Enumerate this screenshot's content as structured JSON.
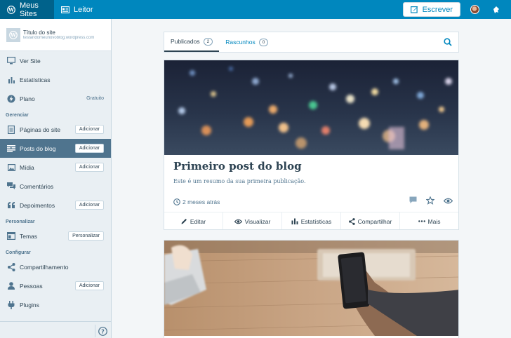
{
  "masterbar": {
    "my_sites": "Meus Sites",
    "reader": "Leitor",
    "write": "Escrever",
    "icons": [
      "wordpress-icon",
      "reader-icon",
      "write-icon",
      "avatar",
      "notifications-icon"
    ]
  },
  "site": {
    "title": "Título do site",
    "url": "testandomeunovoblog.wordpress.com"
  },
  "sidebar": {
    "top_items": [
      {
        "label": "Ver Site",
        "icon": "monitor-icon"
      },
      {
        "label": "Estatísticas",
        "icon": "stats-icon"
      },
      {
        "label": "Plano",
        "icon": "plan-icon",
        "extra": "Gratuito"
      }
    ],
    "manage_heading": "Gerenciar",
    "manage_items": [
      {
        "label": "Páginas do site",
        "button": "Adicionar",
        "icon": "pages-icon"
      },
      {
        "label": "Posts do blog",
        "button": "Adicionar",
        "icon": "posts-icon",
        "selected": true
      },
      {
        "label": "Mídia",
        "button": "Adicionar",
        "icon": "media-icon"
      },
      {
        "label": "Comentários",
        "icon": "comments-icon"
      },
      {
        "label": "Depoimentos",
        "button": "Adicionar",
        "icon": "quote-icon"
      }
    ],
    "personalize_heading": "Personalizar",
    "personalize_items": [
      {
        "label": "Temas",
        "button": "Personalizar",
        "icon": "themes-icon"
      }
    ],
    "configure_heading": "Configurar",
    "configure_items": [
      {
        "label": "Compartilhamento",
        "icon": "share-icon"
      },
      {
        "label": "Pessoas",
        "button": "Adicionar",
        "icon": "people-icon"
      },
      {
        "label": "Plugins",
        "icon": "plugins-icon"
      }
    ],
    "help_icon": "help-icon"
  },
  "tabs": {
    "published": "Publicados",
    "published_count": "2",
    "drafts": "Rascunhos",
    "drafts_count": "0"
  },
  "post": {
    "title": "Primeiro post do blog",
    "excerpt": "Este é um resumo da sua primeira publicação.",
    "time": "2 meses atrás",
    "actions": {
      "edit": "Editar",
      "view": "Visualizar",
      "stats": "Estatísticas",
      "share": "Compartilhar",
      "more": "Mais"
    }
  },
  "colors": {
    "masterbar": "#0087be",
    "masterbar_active": "#00628b",
    "sidebar_bg": "#e9eff3",
    "selected": "#4f748e",
    "link": "#0087be"
  }
}
